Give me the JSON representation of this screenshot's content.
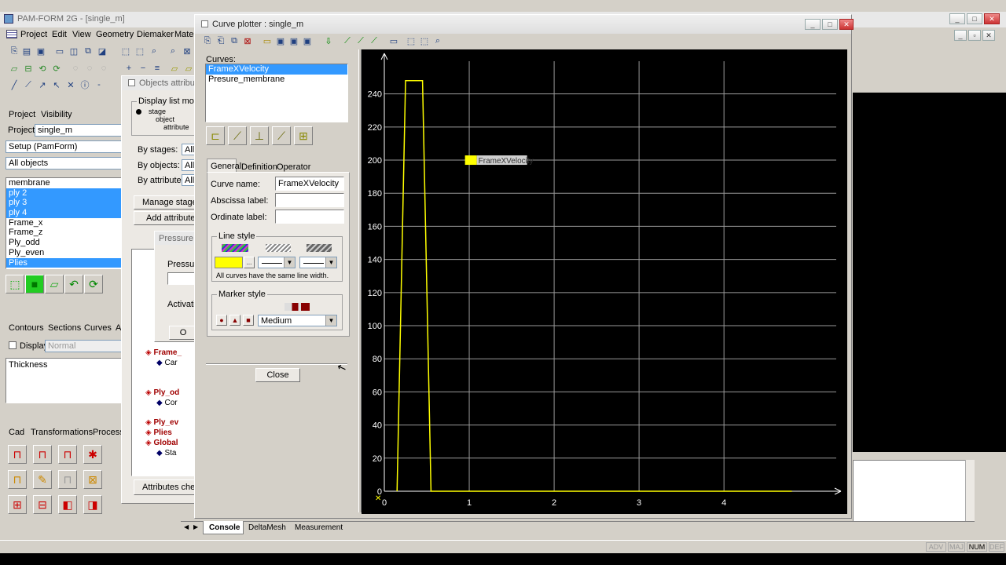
{
  "main_window": {
    "title": "PAM-FORM 2G - [single_m]",
    "menu": [
      "Project",
      "Edit",
      "View",
      "Geometry",
      "Diemaker",
      "Mate"
    ],
    "status_indicators": [
      "ADV",
      "MAJ",
      "NUM",
      "DEF"
    ]
  },
  "left_panel": {
    "tabs1": [
      "Project",
      "Visibility"
    ],
    "project_label": "Project :",
    "project_value": "single_m",
    "setup_value": "Setup (PamForm)",
    "filter_value": "All objects",
    "list_items": [
      {
        "label": "membrane",
        "selected": false
      },
      {
        "label": "ply 2",
        "selected": true
      },
      {
        "label": "ply 3",
        "selected": true
      },
      {
        "label": "ply 4",
        "selected": true
      },
      {
        "label": "Frame_x",
        "selected": false
      },
      {
        "label": "Frame_z",
        "selected": false
      },
      {
        "label": "Ply_odd",
        "selected": false
      },
      {
        "label": "Ply_even",
        "selected": false
      },
      {
        "label": "Plies",
        "selected": true
      }
    ],
    "tabs2": [
      "Contours",
      "Sections",
      "Curves",
      "A"
    ],
    "display_label": "Display",
    "display_value": "Normal",
    "thickness_value": "Thickness",
    "tabs3": [
      "Cad",
      "Transformations",
      "Process"
    ]
  },
  "objects_window": {
    "title": "Objects attribute",
    "display_list_mode": "Display list mode",
    "modes": [
      "stage",
      "object",
      "attribute"
    ],
    "by_stages_label": "By stages:",
    "by_objects_label": "By objects:",
    "by_attributes_label": "By attributes:",
    "all_value": "All",
    "manage_stages": "Manage stages...",
    "add_attributes": "Add attributes",
    "attributes_check": "Attributes check",
    "tree_items": [
      {
        "label": "Frame_",
        "style": "red",
        "indent": 0
      },
      {
        "label": "Car",
        "style": "normal",
        "indent": 1
      },
      {
        "label": "Ply_od",
        "style": "red",
        "indent": 0
      },
      {
        "label": "Cor",
        "style": "normal",
        "indent": 1
      },
      {
        "label": "Ply_ev",
        "style": "red",
        "indent": 0
      },
      {
        "label": "Plies",
        "style": "red",
        "indent": 0
      },
      {
        "label": "Global",
        "style": "red",
        "indent": 0
      },
      {
        "label": "Sta",
        "style": "normal",
        "indent": 1
      }
    ]
  },
  "pressure_window": {
    "title": "Pressure",
    "pressure_label": "Pressure",
    "activation_label": "Activatio",
    "ok_label": "O"
  },
  "curve_plotter": {
    "title": "Curve plotter : single_m",
    "curves_label": "Curves:",
    "curves": [
      {
        "label": "FrameXVelocity",
        "selected": true
      },
      {
        "label": "Presure_membrane",
        "selected": false
      }
    ],
    "tabs": [
      "General",
      "Definition",
      "Operator"
    ],
    "curve_name_label": "Curve name:",
    "curve_name_value": "FrameXVelocity",
    "abscissa_label": "Abscissa label:",
    "abscissa_value": "",
    "ordinate_label": "Ordinate label:",
    "ordinate_value": "",
    "line_style_label": "Line style",
    "line_style_note": "All curves have the same line width.",
    "marker_style_label": "Marker style",
    "marker_size": "Medium",
    "close_label": "Close",
    "curve_color": "#ffff00"
  },
  "bottom_tabs": [
    "Console",
    "DeltaMesh",
    "Measurement"
  ],
  "chart_data": {
    "type": "line",
    "series": [
      {
        "name": "FrameXVelocity",
        "color": "#ffff00",
        "points": [
          [
            0.15,
            0
          ],
          [
            0.25,
            248
          ],
          [
            0.45,
            248
          ],
          [
            0.55,
            0
          ],
          [
            4.8,
            0
          ]
        ]
      }
    ],
    "x_ticks": [
      0,
      1,
      2,
      3,
      4
    ],
    "y_ticks": [
      0,
      20,
      40,
      60,
      80,
      100,
      120,
      140,
      160,
      180,
      200,
      220,
      240
    ],
    "xlim": [
      0,
      5.1
    ],
    "ylim": [
      0,
      255
    ],
    "legend_label": "FrameXVelocity",
    "grid": true,
    "background": "#000000"
  }
}
